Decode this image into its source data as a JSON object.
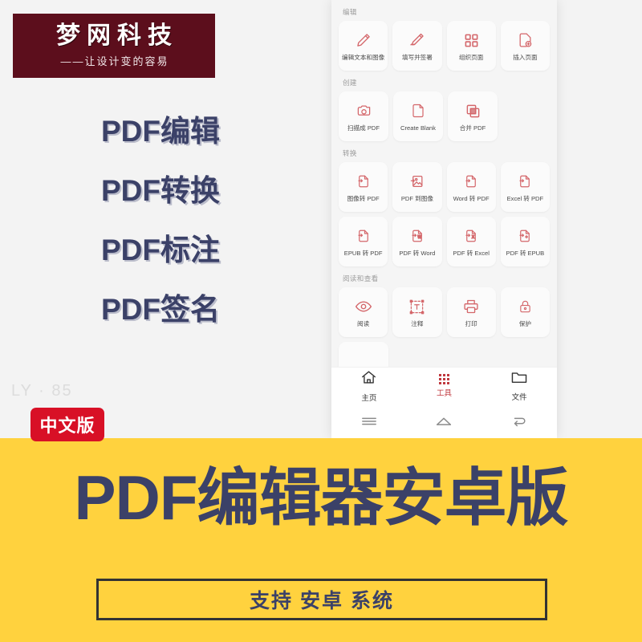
{
  "brand": {
    "name": "梦网科技",
    "tagline": "——让设计变的容易"
  },
  "promo_lines": [
    "PDF编辑",
    "PDF转换",
    "PDF标注",
    "PDF签名"
  ],
  "watermark": "LY · 85",
  "language_badge": "中文版",
  "banner": {
    "title": "PDF编辑器安卓版",
    "support_text": "支持 安卓 系统"
  },
  "colors": {
    "brand_maroon": "#5c0e1c",
    "navy": "#3b4168",
    "yellow": "#ffd23e",
    "red": "#d81026",
    "tool_red": "#c0393f"
  },
  "phone": {
    "sections": [
      {
        "label": "编辑",
        "tiles": [
          {
            "label": "编辑文本和图像",
            "icon": "pencil-icon"
          },
          {
            "label": "填写并签署",
            "icon": "sign-pen-icon"
          },
          {
            "label": "组织页面",
            "icon": "grid-squares-icon"
          },
          {
            "label": "插入页面",
            "icon": "page-add-icon"
          }
        ]
      },
      {
        "label": "创建",
        "tiles": [
          {
            "label": "扫描成 PDF",
            "icon": "camera-icon"
          },
          {
            "label": "Create Blank",
            "icon": "blank-page-icon"
          },
          {
            "label": "合并 PDF",
            "icon": "merge-squares-icon"
          }
        ]
      },
      {
        "label": "转换",
        "tiles": [
          {
            "label": "图像转 PDF",
            "icon": "convert-page-icon"
          },
          {
            "label": "PDF 到图像",
            "icon": "convert-image-icon"
          },
          {
            "label": "Word 转 PDF",
            "icon": "convert-page-icon"
          },
          {
            "label": "Excel 转 PDF",
            "icon": "convert-page-icon"
          },
          {
            "label": "EPUB 转 PDF",
            "icon": "convert-page-icon"
          },
          {
            "label": "PDF 转 Word",
            "icon": "convert-word-icon"
          },
          {
            "label": "PDF 转 Excel",
            "icon": "convert-excel-icon"
          },
          {
            "label": "PDF 转 EPUB",
            "icon": "convert-epub-icon"
          }
        ]
      },
      {
        "label": "阅读和查看",
        "tiles": [
          {
            "label": "阅读",
            "icon": "eye-icon"
          },
          {
            "label": "注释",
            "icon": "text-box-icon"
          },
          {
            "label": "打印",
            "icon": "printer-icon"
          },
          {
            "label": "保护",
            "icon": "lock-icon"
          }
        ]
      }
    ],
    "tabbar": [
      {
        "label": "主页",
        "icon": "home-icon",
        "active": false
      },
      {
        "label": "工具",
        "icon": "tools-grid-icon",
        "active": true
      },
      {
        "label": "文件",
        "icon": "folder-icon",
        "active": false
      }
    ],
    "system_nav": [
      "menu-icon",
      "home-outline-icon",
      "back-icon"
    ]
  }
}
